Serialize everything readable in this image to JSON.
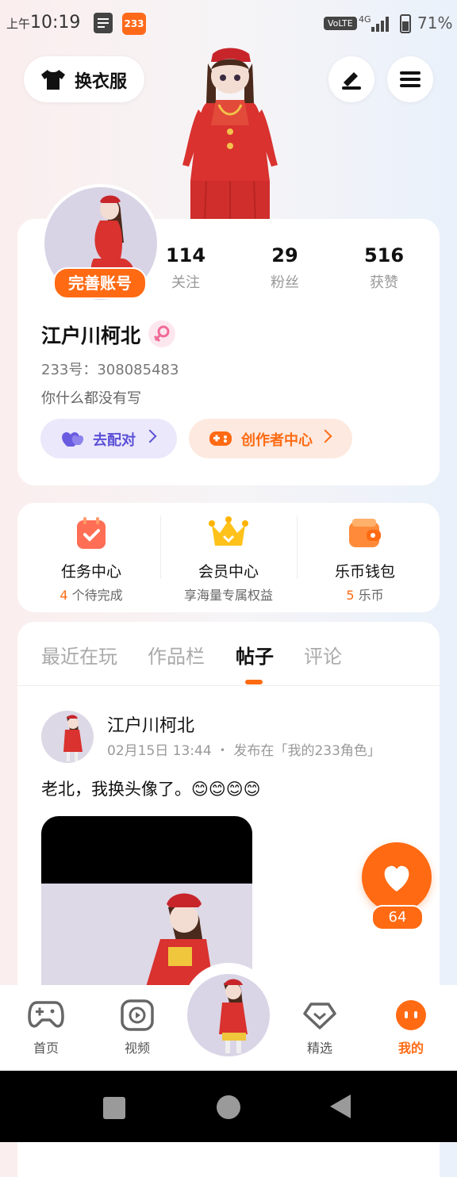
{
  "status_bar": {
    "time_prefix": "上午",
    "time": "10:19",
    "app_badge": "233",
    "volte": "VoLTE",
    "network": "4G",
    "battery": "71%"
  },
  "header": {
    "outfit_label": "换衣服"
  },
  "profile": {
    "complete_label": "完善账号",
    "stats": [
      {
        "value": "114",
        "label": "关注"
      },
      {
        "value": "29",
        "label": "粉丝"
      },
      {
        "value": "516",
        "label": "获赞"
      }
    ],
    "username": "江户川柯北",
    "id_line": "233号：308085483",
    "bio": "你什么都没有写",
    "match_label": "去配对",
    "creator_label": "创作者中心"
  },
  "services": [
    {
      "title": "任务中心",
      "count": "4",
      "sub": " 个待完成"
    },
    {
      "title": "会员中心",
      "count": "",
      "sub": "享海量专属权益"
    },
    {
      "title": "乐币钱包",
      "count": "5",
      "sub": " 乐币"
    }
  ],
  "tabs": [
    "最近在玩",
    "作品栏",
    "帖子",
    "评论"
  ],
  "post": {
    "author": "江户川柯北",
    "meta": "02月15日 13:44 ・ 发布在「我的233角色」",
    "text": "老北，我换头像了。😊😊😊😊",
    "likes": "64"
  },
  "bottom_nav": [
    {
      "label": "首页",
      "icon": "gamepad-icon"
    },
    {
      "label": "视频",
      "icon": "video-play-icon"
    },
    {
      "label": "精选",
      "icon": "heart-diamond-icon"
    },
    {
      "label": "我的",
      "icon": "face-icon"
    }
  ],
  "colors": {
    "accent": "#ff6a13",
    "match_bg": "#ebe8fb",
    "match_fg": "#5b50d6",
    "creator_bg": "#fde9df",
    "creator_fg": "#ff6a13"
  }
}
